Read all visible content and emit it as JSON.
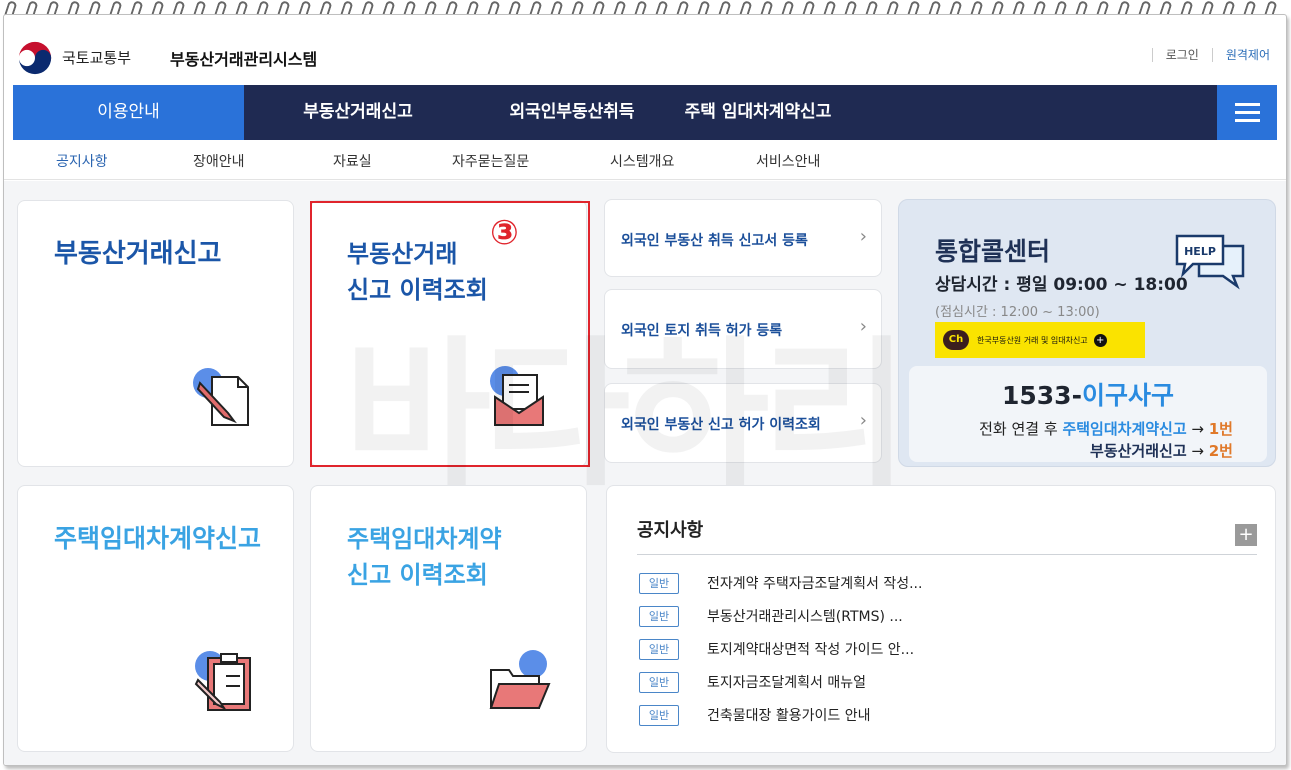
{
  "header": {
    "ministry": "국토교통부",
    "system_title": "부동산거래관리시스템",
    "login": "로그인",
    "remote": "원격제어"
  },
  "main_nav": [
    {
      "label": "이용안내",
      "active": true
    },
    {
      "label": "부동산거래신고"
    },
    {
      "label": "외국인부동산취득"
    },
    {
      "label": "주택 임대차계약신고"
    }
  ],
  "sub_nav": [
    {
      "label": "공지사항",
      "active": true
    },
    {
      "label": "장애안내"
    },
    {
      "label": "자료실"
    },
    {
      "label": "자주묻는질문"
    },
    {
      "label": "시스템개요"
    },
    {
      "label": "서비스안내"
    }
  ],
  "cards": {
    "trade_report": {
      "title": "부동산거래신고",
      "icon": "pen-document-icon"
    },
    "trade_history": {
      "title_line1": "부동산거래",
      "title_line2": "신고 이력조회",
      "icon": "envelope-icon"
    },
    "lease_report": {
      "title": "주택임대차계약신고",
      "icon": "clipboard-icon"
    },
    "lease_history": {
      "title_line1": "주택임대차계약",
      "title_line2": "신고 이력조회",
      "icon": "folder-icon"
    }
  },
  "annotation": {
    "marker": "③",
    "color": "#e0242c"
  },
  "foreign_links": [
    {
      "label": "외국인 부동산 취득 신고서 등록"
    },
    {
      "label": "외국인 토지 취득 허가 등록"
    },
    {
      "label": "외국인 부동산 신고 허가 이력조회"
    }
  ],
  "call_center": {
    "title": "통합콜센터",
    "hours": "상담시간 : 평일 09:00 ~ 18:00",
    "lunch": "(점심시간 : 12:00 ~ 13:00)",
    "kakao_badge": "Ch",
    "kakao_text": "한국부동산원 거래 및 임대차신고",
    "help_bubble": "HELP",
    "number_prefix": "1533-",
    "number_rest": "이구사구",
    "line1_prefix": "전화 연결 후 ",
    "line1_highlight": "주택임대차계약신고",
    "line1_arrow": " → ",
    "line1_choice": "1번",
    "line2_highlight": "부동산거래신고",
    "line2_arrow": " → ",
    "line2_choice": "2번"
  },
  "notices": {
    "title": "공지사항",
    "more": "+",
    "items": [
      {
        "badge": "일반",
        "text": "전자계약 주택자금조달계획서 작성..."
      },
      {
        "badge": "일반",
        "text": "부동산거래관리시스템(RTMS) ..."
      },
      {
        "badge": "일반",
        "text": "토지계약대상면적 작성 가이드 안..."
      },
      {
        "badge": "일반",
        "text": "토지자금조달계획서 매뉴얼"
      },
      {
        "badge": "일반",
        "text": "건축물대장 활용가이드 안내"
      }
    ]
  },
  "watermark": "바다하리",
  "colors": {
    "navy": "#1f2a52",
    "blue": "#2a72d9",
    "title_blue": "#1b56a8",
    "sky": "#3aa3e3",
    "red": "#e0242c"
  }
}
